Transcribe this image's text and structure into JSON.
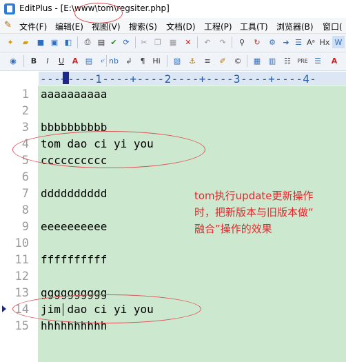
{
  "window": {
    "title": "EditPlus - [E:\\www\\tom\\regsiter.php]"
  },
  "menu": [
    "文件(F)",
    "编辑(E)",
    "视图(V)",
    "搜索(S)",
    "文档(D)",
    "工程(P)",
    "工具(T)",
    "浏览器(B)",
    "窗口("
  ],
  "toolbar2": {
    "nb": "nb",
    "hi": "Hi"
  },
  "ruler": {
    "text": "---+----1----+----2----+----3----+----4-"
  },
  "lines": [
    {
      "num": "1",
      "text": "aaaaaaaaaa"
    },
    {
      "num": "2",
      "text": ""
    },
    {
      "num": "3",
      "text": "bbbbbbbbbb"
    },
    {
      "num": "4",
      "text": "tom dao ci yi you"
    },
    {
      "num": "5",
      "text": "cccccccccc"
    },
    {
      "num": "6",
      "text": ""
    },
    {
      "num": "7",
      "text": "dddddddddd"
    },
    {
      "num": "8",
      "text": ""
    },
    {
      "num": "9",
      "text": "eeeeeeeeee"
    },
    {
      "num": "10",
      "text": ""
    },
    {
      "num": "11",
      "text": "ffffffffff"
    },
    {
      "num": "12",
      "text": ""
    },
    {
      "num": "13",
      "text": "gggggggggg"
    },
    {
      "num": "14",
      "text": "jim dao ci yi you"
    },
    {
      "num": "15",
      "text": "hhhhhhhhhh"
    }
  ],
  "annotation": {
    "line1": "tom执行update更新操作",
    "line2": "时，把新版本与旧版本做“",
    "line3": "融合”操作的效果",
    "color": "#e8252a"
  },
  "colors": {
    "editor_bg": "#cce8cf",
    "ruler_bg": "#dde7f4",
    "ruler_text": "#1f5fae"
  }
}
